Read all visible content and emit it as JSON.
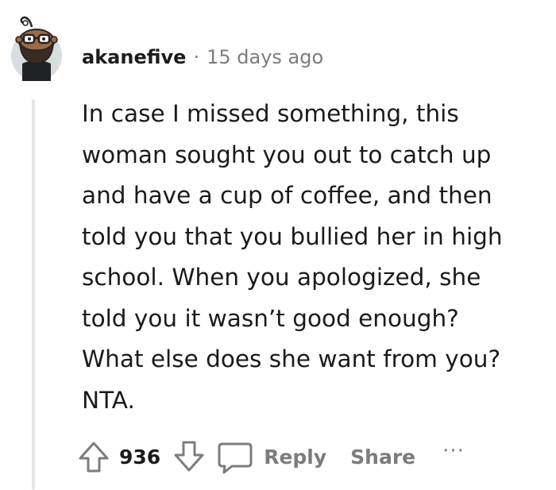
{
  "comment": {
    "author": "akanefive",
    "separator": "·",
    "timestamp": "15 days ago",
    "body_lines": [
      "In case I missed something, this",
      "woman sought you out to catch up",
      "and have a cup of coffee, and then",
      "told you that you bullied her in high",
      "school. When you apologized, she",
      "told you it wasn’t good enough?",
      "What else does she want from you?",
      "NTA."
    ],
    "score": "936"
  },
  "actions": {
    "upvote_icon": "arrow-up-icon",
    "downvote_icon": "arrow-down-icon",
    "reply_icon": "speech-bubble-icon",
    "reply_label": "Reply",
    "share_label": "Share",
    "more_label": "···"
  },
  "colors": {
    "text": "#1c1c1c",
    "muted": "#7c7c7c",
    "thread_line": "#e4e6e8",
    "avatar_bg": "#d8dde0"
  }
}
